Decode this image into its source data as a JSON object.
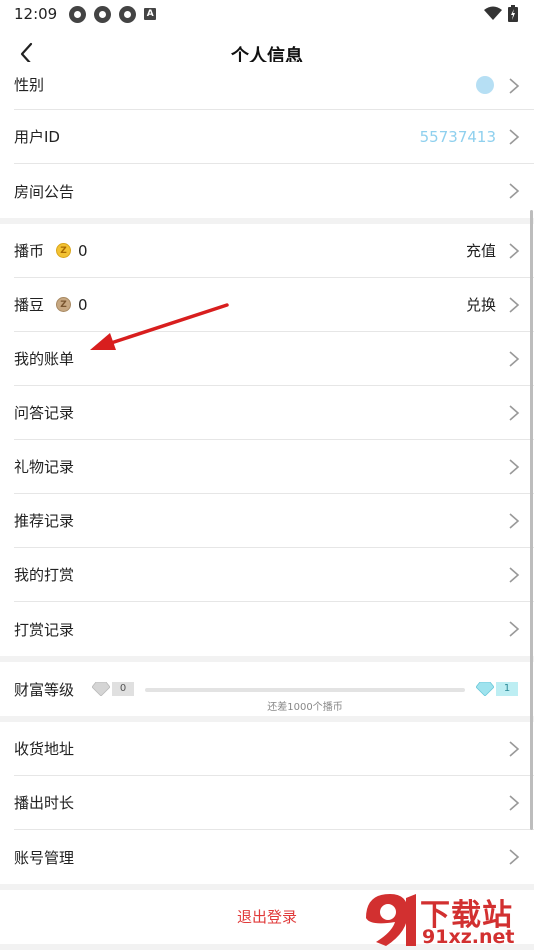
{
  "status_bar": {
    "time": "12:09"
  },
  "header": {
    "title": "个人信息"
  },
  "group1": [
    {
      "label": "性别",
      "value": ""
    },
    {
      "label": "用户ID",
      "value": "55737413"
    },
    {
      "label": "房间公告",
      "value": ""
    }
  ],
  "group2": [
    {
      "label": "播币",
      "coin_count": "0",
      "action": "充值",
      "coin_glyph": "Z"
    },
    {
      "label": "播豆",
      "coin_count": "0",
      "action": "兑换",
      "coin_glyph": "Z"
    },
    {
      "label": "我的账单"
    },
    {
      "label": "问答记录"
    },
    {
      "label": "礼物记录"
    },
    {
      "label": "推荐记录"
    },
    {
      "label": "我的打赏"
    },
    {
      "label": "打赏记录"
    }
  ],
  "wealth": {
    "label": "财富等级",
    "current_level": "0",
    "next_level": "1",
    "progress_fraction": 0,
    "progress_text": "还差1000个播币"
  },
  "group3": [
    {
      "label": "收货地址"
    },
    {
      "label": "播出时长"
    },
    {
      "label": "账号管理"
    }
  ],
  "logout": {
    "label": "退出登录"
  },
  "watermark": {
    "title": "下载站",
    "url": "91xz.net"
  },
  "colors": {
    "accent_blue": "#8fd0ee",
    "logout_red": "#e03a3a",
    "annotation_arrow": "#d81e1e"
  }
}
